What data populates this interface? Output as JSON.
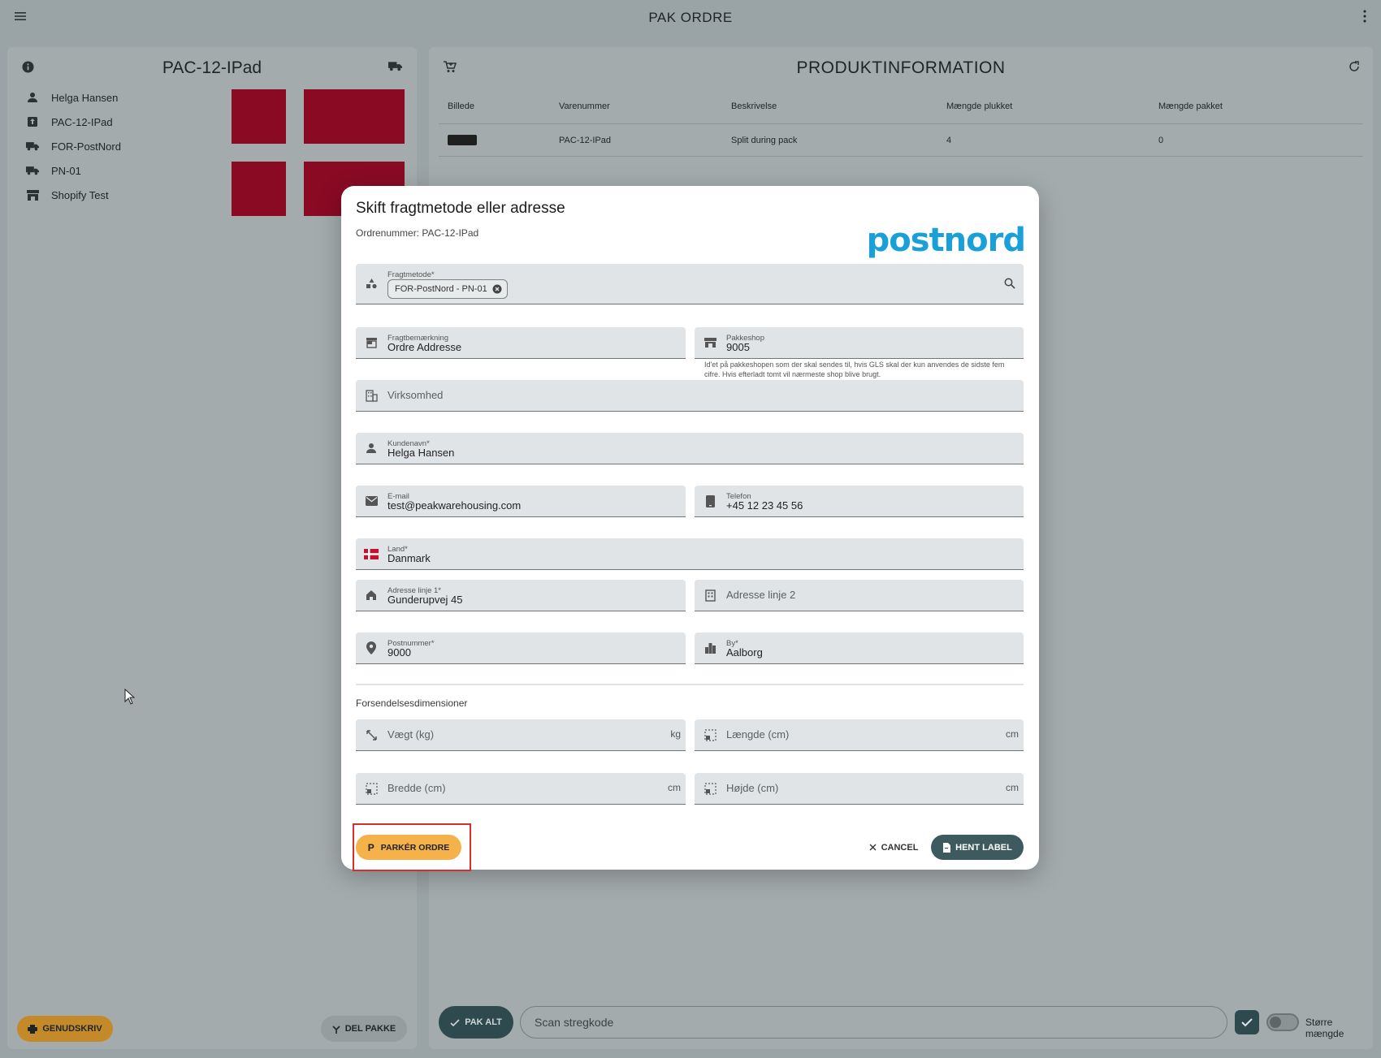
{
  "topbar": {
    "title": "PAK ORDRE"
  },
  "left": {
    "title": "PAC-12-IPad",
    "items": [
      {
        "icon": "person-icon",
        "label": "Helga Hansen"
      },
      {
        "icon": "package-icon",
        "label": "PAC-12-IPad"
      },
      {
        "icon": "truck-icon",
        "label": "FOR-PostNord"
      },
      {
        "icon": "truck-icon",
        "label": "PN-01"
      },
      {
        "icon": "store-icon",
        "label": "Shopify Test"
      }
    ],
    "reprint_label": "GENUDSKRIV",
    "split_label": "DEL PAKKE"
  },
  "right": {
    "title": "PRODUKTINFORMATION",
    "columns": [
      "Billede",
      "Varenummer",
      "Beskrivelse",
      "Mængde plukket",
      "Mængde pakket"
    ],
    "rows": [
      {
        "sku": "PAC-12-IPad",
        "description": "Split during pack",
        "picked": "4",
        "packed": "0"
      }
    ],
    "pak_alt_label": "PAK ALT",
    "scan_placeholder": "Scan stregkode",
    "toggle_label": "Større mængde"
  },
  "dialog": {
    "title": "Skift fragtmetode eller adresse",
    "order_label": "Ordrenummer: PAC-12-IPad",
    "logo_text": "postnord",
    "freight_method": {
      "label": "Fragtmetode*",
      "chip": "FOR-PostNord - PN-01"
    },
    "freight_note": {
      "label": "Fragtbemærkning",
      "value": "Ordre Addresse"
    },
    "parcelshop": {
      "label": "Pakkeshop",
      "value": "9005",
      "hint": "Id'et på pakkeshopen som der skal sendes til, hvis GLS skal der kun anvendes de sidste fem cifre. Hvis efterladt tomt vil nærmeste shop blive brugt."
    },
    "company": {
      "placeholder": "Virksomhed"
    },
    "customer_name": {
      "label": "Kundenavn*",
      "value": "Helga Hansen"
    },
    "email": {
      "label": "E-mail",
      "value": "test@peakwarehousing.com"
    },
    "phone": {
      "label": "Telefon",
      "value": "+45 12 23 45 56"
    },
    "country": {
      "label": "Land*",
      "value": "Danmark"
    },
    "address1": {
      "label": "Adresse linje 1*",
      "value": "Gunderupvej 45"
    },
    "address2": {
      "placeholder": "Adresse linje 2"
    },
    "postal": {
      "label": "Postnummer*",
      "value": "9000"
    },
    "city": {
      "label": "By*",
      "value": "Aalborg"
    },
    "dimensions_title": "Forsendelsesdimensioner",
    "weight": {
      "placeholder": "Vægt (kg)",
      "suffix": "kg"
    },
    "length": {
      "placeholder": "Længde (cm)",
      "suffix": "cm"
    },
    "width": {
      "placeholder": "Bredde (cm)",
      "suffix": "cm"
    },
    "height": {
      "placeholder": "Højde (cm)",
      "suffix": "cm"
    },
    "park_label": "PARKÉR ORDRE",
    "park_icon_letter": "P",
    "cancel_label": "CANCEL",
    "get_label": "HENT LABEL"
  },
  "colors": {
    "accent_orange": "#f5b24a",
    "primary_teal": "#3d5a5f",
    "postnord_blue": "#1aa0d8",
    "flag_red": "#c8102e"
  }
}
